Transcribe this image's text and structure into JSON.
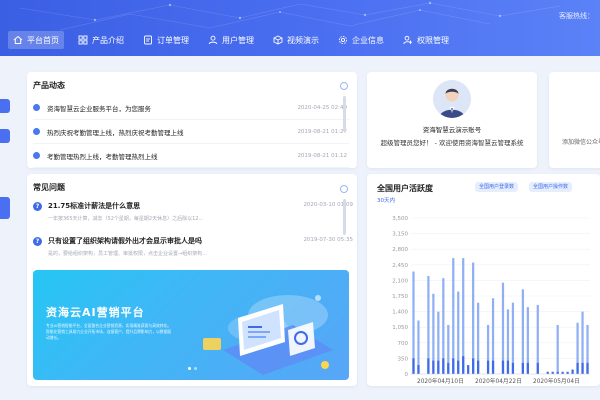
{
  "header": {
    "hotline_label": "客服热线：",
    "nav": [
      {
        "label": "平台首页",
        "icon": "home-icon",
        "active": true
      },
      {
        "label": "产品介绍",
        "icon": "grid-icon",
        "active": false
      },
      {
        "label": "订单管理",
        "icon": "order-icon",
        "active": false
      },
      {
        "label": "用户管理",
        "icon": "user-icon",
        "active": false
      },
      {
        "label": "视频演示",
        "icon": "cube-icon",
        "active": false
      },
      {
        "label": "企业信息",
        "icon": "gear-icon",
        "active": false
      },
      {
        "label": "权限管理",
        "icon": "permission-icon",
        "active": false
      }
    ]
  },
  "product_news": {
    "title": "产品动态",
    "items": [
      {
        "text": "资海智慧云企业服务平台，为您服务",
        "date": "2020-04-25 02:49"
      },
      {
        "text": "热烈庆祝考勤管理上线，热烈庆祝考勤管理上线",
        "date": "2019-08-21 01:27"
      },
      {
        "text": "考勤管理热烈上线，考勤管理热烈上线",
        "date": "2019-08-21 01:12"
      }
    ]
  },
  "faq": {
    "title": "常见问题",
    "items": [
      {
        "question": "21.75标准计薪法是什么意思",
        "answer": "一年按365天计算，减去（52个星期，每星期2天休息）之后除以12...",
        "date": "2020-03-10 01:09"
      },
      {
        "question": "只有设置了组织架构请假外出才会显示审批人是吗",
        "answer": "是的，要给组织架构，员工管理、审批权限，点击企业设置→组织架构...",
        "date": "2019-07-30 05:35"
      }
    ]
  },
  "banner": {
    "title": "资海云AI营销平台",
    "description": "专业AI营销智能平台，全面整合企业营销资源，实现精准获客与高效转化。智能化营销工具助力企业开拓市场，连接客户，提升品牌影响力，以数据驱动增长。"
  },
  "account": {
    "name": "资海智慧云演示账号",
    "welcome": "超级管理员您好！ - 欢迎使用资海智慧云管理系统"
  },
  "partial_card": {
    "text": "添加微信公众号"
  },
  "chart": {
    "title": "全国用户活跃度",
    "subtitle": "30天内",
    "pill_1": "全国用户登录数",
    "pill_2": "全国用户操作数"
  },
  "chart_data": {
    "type": "bar",
    "title": "全国用户活跃度",
    "subtitle": "30天内",
    "ylim": [
      0,
      3500
    ],
    "yticks": [
      0,
      350,
      700,
      1050,
      1400,
      1750,
      2100,
      2450,
      2800,
      3150,
      3500
    ],
    "xtick_labels": [
      "2020年04月10日",
      "2020年04月22日",
      "2020年05月04日"
    ],
    "grid": true,
    "legend_position": "top-right",
    "series": [
      {
        "name": "全国用户登录数",
        "color": "#8fb0f5",
        "values": [
          2300,
          1200,
          0,
          2200,
          1800,
          1400,
          2150,
          1100,
          2600,
          1850,
          2600,
          0,
          2500,
          1600,
          0,
          1100,
          1700,
          0,
          2050,
          1450,
          1600,
          0,
          1900,
          1500,
          0,
          1550,
          0,
          0,
          0,
          1100,
          0,
          0,
          0,
          1150,
          1400,
          1100
        ]
      },
      {
        "name": "全国用户操作数",
        "color": "#3f6ae8",
        "values": [
          350,
          200,
          0,
          350,
          300,
          300,
          350,
          250,
          350,
          300,
          400,
          200,
          350,
          300,
          0,
          300,
          300,
          0,
          300,
          300,
          250,
          0,
          250,
          250,
          0,
          250,
          0,
          50,
          50,
          50,
          50,
          50,
          100,
          250,
          250,
          250
        ]
      }
    ]
  }
}
